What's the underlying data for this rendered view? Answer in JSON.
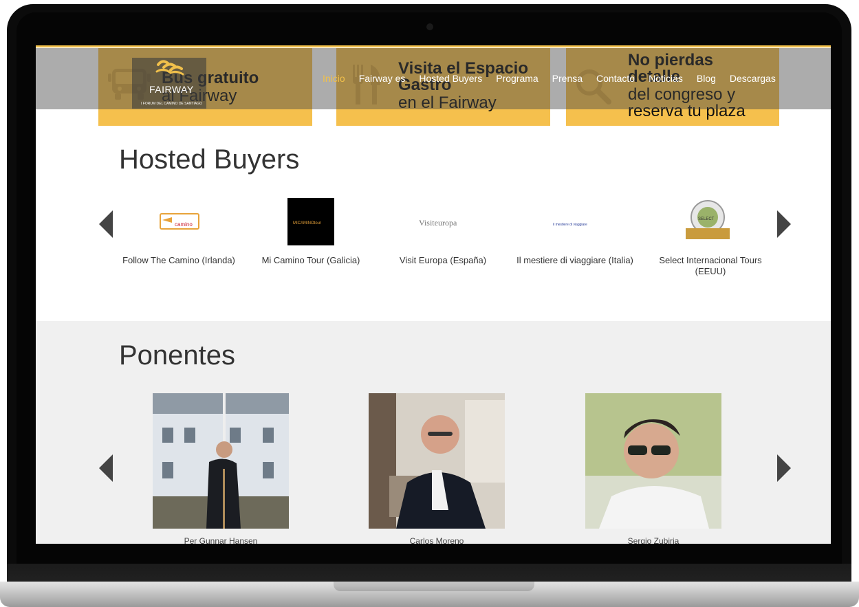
{
  "header": {
    "logo_text": "FAIRWAY",
    "logo_subtitle": "I FORUM DEL CAMINO DE SANTIAGO",
    "nav": [
      "Inicio",
      "Fairway es",
      "Hosted Buyers",
      "Programa",
      "Prensa",
      "Contacto",
      "Noticias",
      "Blog",
      "Descargas"
    ]
  },
  "banners": [
    {
      "bold": "Bus gratuito",
      "light": "al Fairway",
      "icon": "bus-icon"
    },
    {
      "bold": "Visita el Espacio Gastro",
      "light": "en el Fairway",
      "icon": "fork-knife-icon"
    },
    {
      "bold": "No pierdas detalle",
      "light": "del congreso y reserva tu plaza",
      "icon": "search-icon"
    }
  ],
  "hosted_buyers": {
    "title": "Hosted Buyers",
    "items": [
      {
        "name": "Follow The Camino (Irlanda)",
        "logo": "camino"
      },
      {
        "name": "Mi Camino Tour (Galicia)",
        "logo": "MICAMINOtour"
      },
      {
        "name": "Visit Europa (España)",
        "logo": "Visiteuropa"
      },
      {
        "name": "Il mestiere di viaggiare (Italia)",
        "logo": "il mestiere di viaggiare"
      },
      {
        "name": "Select Internacional Tours (EEUU)",
        "logo": "SELECT"
      }
    ]
  },
  "ponentes": {
    "title": "Ponentes",
    "items": [
      {
        "name": "Per Gunnar Hansen"
      },
      {
        "name": "Carlos Moreno"
      },
      {
        "name": "Sergio Zubiria"
      }
    ]
  },
  "colors": {
    "accent": "#f1c04b",
    "banner": "#f5c04d",
    "arrow": "#444444"
  }
}
